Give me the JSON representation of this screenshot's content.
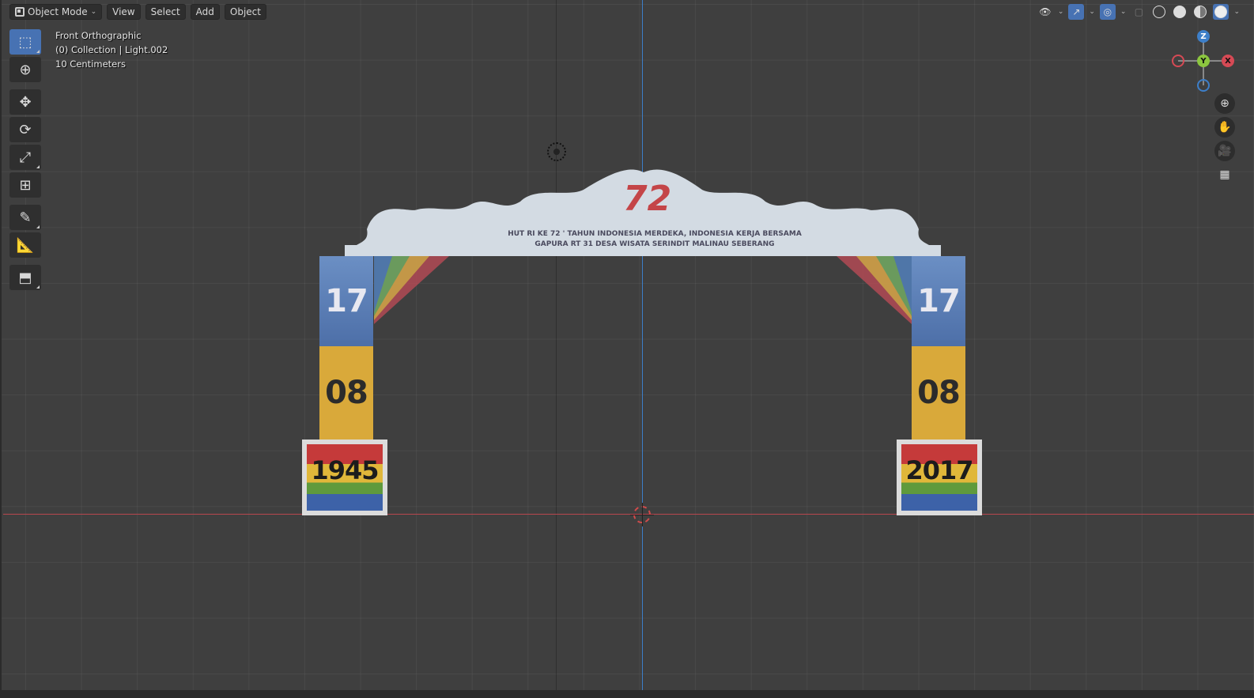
{
  "header": {
    "mode_label": "Object Mode",
    "menus": [
      "View",
      "Select",
      "Add",
      "Object"
    ]
  },
  "overlay": {
    "view_name": "Front Orthographic",
    "collection": "(0) Collection | Light.002",
    "scale": "10 Centimeters"
  },
  "toolbar": {
    "tools": [
      "select-box",
      "cursor",
      "move",
      "rotate",
      "scale",
      "transform",
      "annotate",
      "measure",
      "add-cube"
    ]
  },
  "gizmo": {
    "z": "Z",
    "y": "Y",
    "x": "X"
  },
  "scene": {
    "pillar_top": "17",
    "pillar_mid": "08",
    "left_base": "1945",
    "right_base": "2017",
    "anniversary": "72",
    "banner_line1": "HUT RI KE 72 ' TAHUN INDONESIA MERDEKA, INDONESIA KERJA BERSAMA",
    "banner_line2": "GAPURA RT 31 DESA WISATA SERINDIT MALINAU SEBERANG"
  },
  "colors": {
    "accent": "#4772b3",
    "axis_x": "#b8464f",
    "axis_z": "#3d7fc9",
    "axis_y": "#8cc63f"
  }
}
